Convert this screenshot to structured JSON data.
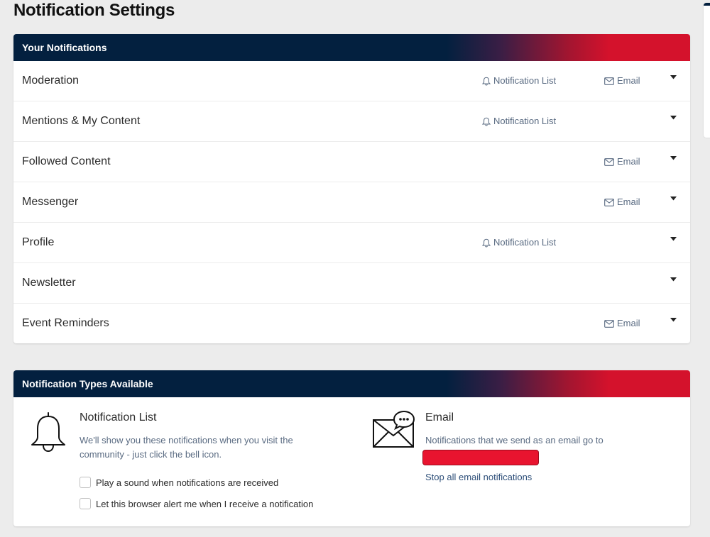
{
  "page": {
    "title": "Notification Settings"
  },
  "your_notifications": {
    "header": "Your Notifications",
    "rows": [
      {
        "label": "Moderation",
        "notification_list": "Notification List",
        "email": "Email"
      },
      {
        "label": "Mentions & My Content",
        "notification_list": "Notification List",
        "email": null
      },
      {
        "label": "Followed Content",
        "notification_list": null,
        "email": "Email"
      },
      {
        "label": "Messenger",
        "notification_list": null,
        "email": "Email"
      },
      {
        "label": "Profile",
        "notification_list": "Notification List",
        "email": null
      },
      {
        "label": "Newsletter",
        "notification_list": null,
        "email": null
      },
      {
        "label": "Event Reminders",
        "notification_list": null,
        "email": "Email"
      }
    ]
  },
  "types_available": {
    "header": "Notification Types Available",
    "notification_list": {
      "title": "Notification List",
      "desc_line1": "We'll show you these notifications when you visit the",
      "desc_line2": "community - just click the bell icon.",
      "option_sound": "Play a sound when notifications are received",
      "option_browser": "Let this browser alert me when I receive a notification"
    },
    "email": {
      "title": "Email",
      "desc": "Notifications that we send as an email go to",
      "stop_link": "Stop all email notifications"
    }
  },
  "colors": {
    "header_navy": "#03203f",
    "header_red": "#d4122c",
    "muted_text": "#5a6b82",
    "link": "#2e4f79",
    "redaction": "#e8142f"
  }
}
